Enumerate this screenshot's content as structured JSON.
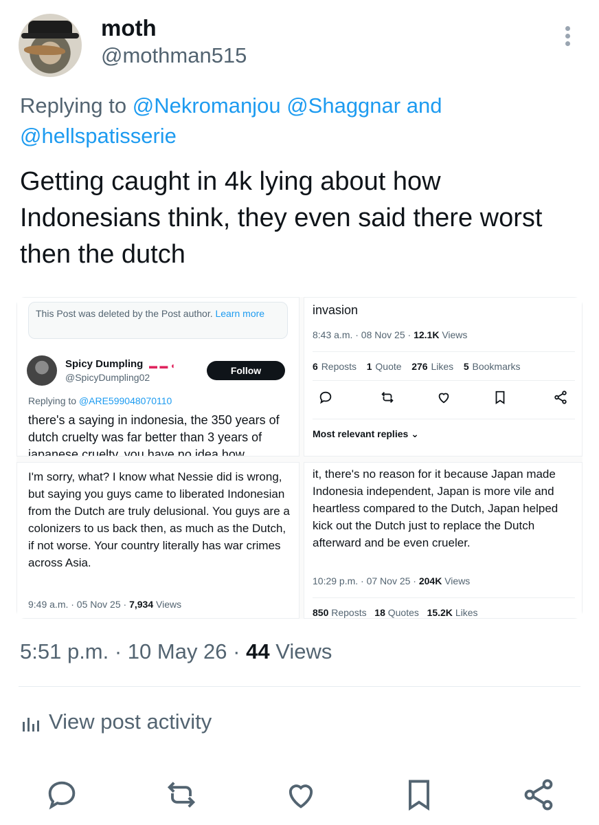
{
  "post": {
    "display_name": "moth",
    "handle": "@mothman515",
    "replying_prefix": "Replying to",
    "reply_mentions": [
      "@Nekromanjou",
      "@Shaggnar",
      "@hellspatisserie"
    ],
    "reply_and": "and",
    "text": "Getting caught in 4k lying about how Indonesians think, they even said there worst then the dutch",
    "timestamp": "5:51 p.m. · 10 May 26 · ",
    "views_count": "44",
    "views_label": "Views",
    "view_activity": "View post activity"
  },
  "media": {
    "panel1": {
      "deleted_notice": "This Post was deleted by the Post author.",
      "learn_more": "Learn more",
      "name": "Spicy Dumpling",
      "flags": "▬ ▬ ◖",
      "handle": "@SpicyDumpling02",
      "follow": "Follow",
      "replying_prefix": "Replying to",
      "replying_mention": "@ARE599048070110",
      "text": "there's a saying in indonesia, the 350 years of dutch cruelty was far better than 3 years of japanese cruelty. you have no idea how"
    },
    "panel2": {
      "top_text": "invasion",
      "meta": "8:43 a.m. · 08 Nov 25 · ",
      "views_count": "12.1K",
      "views_label": "Views",
      "reposts_count": "6",
      "reposts_label": "Reposts",
      "quote_count": "1",
      "quote_label": "Quote",
      "likes_count": "276",
      "likes_label": "Likes",
      "bookmarks_count": "5",
      "bookmarks_label": "Bookmarks",
      "most_relevant": "Most relevant replies ⌄"
    },
    "panel3": {
      "text": "I'm sorry, what? I know what Nessie did is wrong, but saying you guys came to liberated Indonesian from the Dutch are truly delusional. You guys are a colonizers to us back then, as much as the Dutch, if not worse. Your country literally has war crimes across Asia.",
      "meta": "9:49 a.m. · 05 Nov 25 · ",
      "views_count": "7,934",
      "views_label": "Views"
    },
    "panel4": {
      "text": "it, there's no reason for it because Japan made Indonesia independent, Japan is more vile and heartless compared to the Dutch, Japan helped kick out the Dutch just to replace the Dutch afterward and be even crueler.",
      "meta": "10:29 p.m. · 07 Nov 25 · ",
      "views_count": "204K",
      "views_label": "Views",
      "reposts_count": "850",
      "reposts_label": "Reposts",
      "quotes_count": "18",
      "quotes_label": "Quotes",
      "likes_count": "15.2K",
      "likes_label": "Likes"
    }
  },
  "actions": [
    "reply-icon",
    "repost-icon",
    "like-icon",
    "bookmark-icon",
    "share-icon"
  ],
  "colors": {
    "text": "#0f1419",
    "secondary": "#536471",
    "link": "#1d9bf0"
  }
}
